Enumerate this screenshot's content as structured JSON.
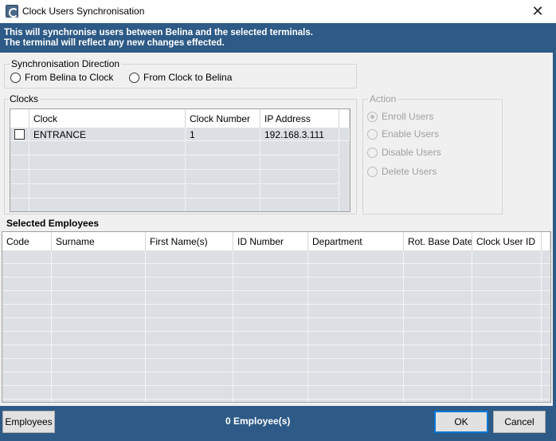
{
  "window": {
    "title": "Clock Users Synchronisation",
    "close_glyph": "✕",
    "icon": "app-icon"
  },
  "banner": {
    "line1": "This will synchronise users between Belina and the selected terminals.",
    "line2": "The terminal will reflect any new changes effected."
  },
  "sync_direction": {
    "legend": "Synchronisation Direction",
    "options": [
      "From Belina to Clock",
      "From Clock to Belina"
    ]
  },
  "clocks": {
    "legend": "Clocks",
    "columns": [
      "Clock",
      "Clock Number",
      "IP Address"
    ],
    "rows": [
      {
        "checked": false,
        "clock": "ENTRANCE",
        "number": "1",
        "ip": "192.168.3.111"
      }
    ]
  },
  "action": {
    "legend": "Action",
    "options": [
      "Enroll Users",
      "Enable Users",
      "Disable Users",
      "Delete Users"
    ],
    "selected": "Enroll Users"
  },
  "employees": {
    "label": "Selected Employees",
    "columns": [
      "Code",
      "Surname",
      "First Name(s)",
      "ID Number",
      "Department",
      "Rot. Base Date",
      "Clock User ID"
    ],
    "rows": []
  },
  "footer": {
    "employees_button": "Employees",
    "count_text": "0 Employee(s)",
    "ok_button": "OK",
    "cancel_button": "Cancel"
  },
  "colors": {
    "accent": "#2d5a86",
    "grid_bg": "#dce0e4",
    "default_button_border": "#0078d7"
  }
}
